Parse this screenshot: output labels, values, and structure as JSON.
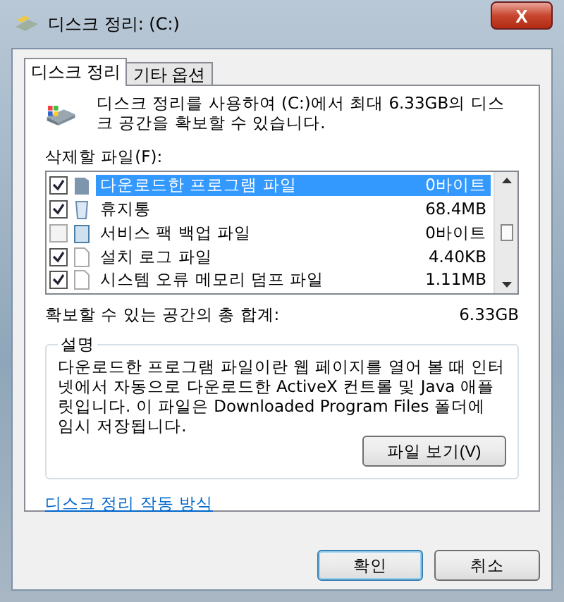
{
  "window": {
    "title": "디스크 정리: (C:)",
    "close": "X"
  },
  "tabs": [
    {
      "label": "디스크 정리",
      "selected": true
    },
    {
      "label": "기타 옵션",
      "selected": false
    }
  ],
  "intro": "디스크 정리를 사용하여 (C:)에서 최대 6.33GB의 디스크 공간을 확보할 수 있습니다.",
  "files_label": "삭제할 파일(F):",
  "files": [
    {
      "name": "다운로드한 프로그램 파일",
      "size": "0바이트",
      "checked": true,
      "selected": true
    },
    {
      "name": "휴지통",
      "size": "68.4MB",
      "checked": true,
      "selected": false
    },
    {
      "name": "서비스 팩 백업 파일",
      "size": "0바이트",
      "checked": false,
      "selected": false
    },
    {
      "name": "설치 로그 파일",
      "size": "4.40KB",
      "checked": true,
      "selected": false
    },
    {
      "name": "시스템 오류 메모리 덤프 파일",
      "size": "1.11MB",
      "checked": true,
      "selected": false
    }
  ],
  "total": {
    "label": "확보할 수 있는 공간의 총 합계:",
    "value": "6.33GB"
  },
  "description": {
    "title": "설명",
    "text": "다운로드한 프로그램 파일이란 웹 페이지를 열어 볼 때 인터넷에서 자동으로 다운로드한 ActiveX 컨트롤 및 Java 애플릿입니다. 이 파일은 Downloaded Program Files 폴더에 임시 저장됩니다.",
    "button": "파일 보기(V)"
  },
  "link": "디스크 정리 작동 방식",
  "buttons": [
    {
      "label": "확인",
      "default": true
    },
    {
      "label": "취소",
      "default": false
    }
  ]
}
